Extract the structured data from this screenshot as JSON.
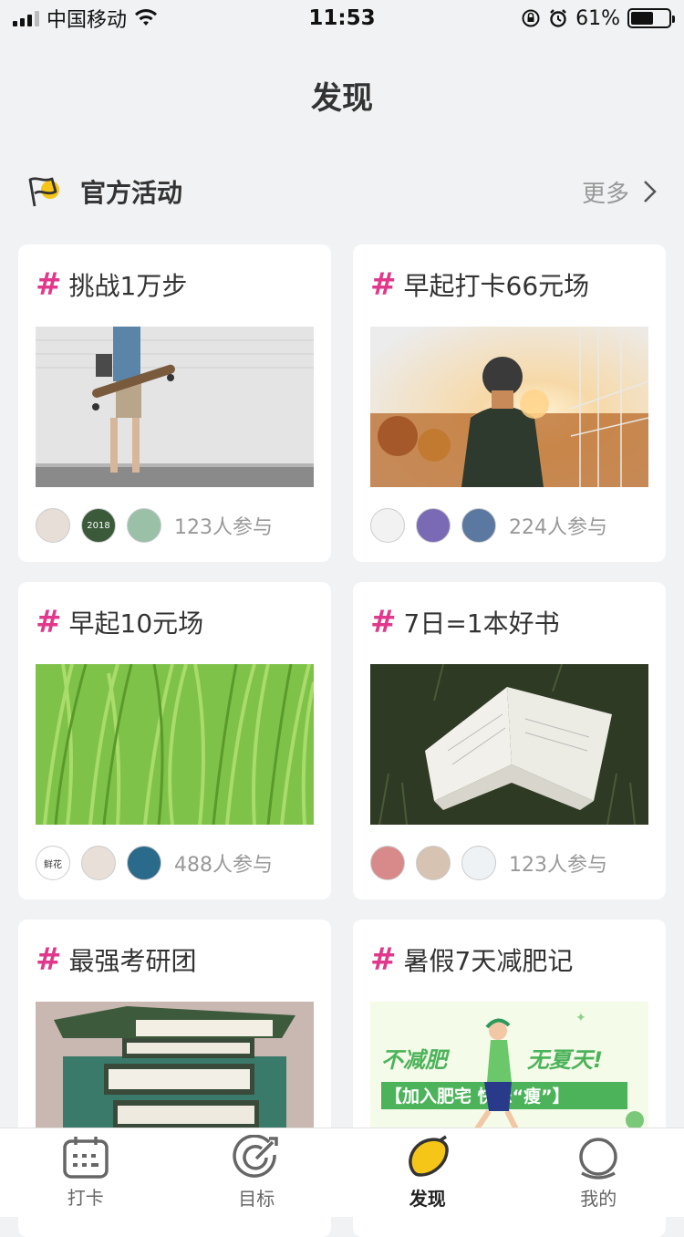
{
  "status_bar": {
    "carrier": "中国移动",
    "time": "11:53",
    "battery_pct": "61%",
    "battery_level": 0.61
  },
  "page": {
    "title": "发现"
  },
  "section": {
    "title": "官方活动",
    "more_label": "更多",
    "flag_color": "#f5c518"
  },
  "activities": [
    {
      "title": "挑战1万步",
      "joined": "123人参与",
      "image": "skateboard-walker-photo",
      "avatar_text": [
        "",
        "2018",
        ""
      ]
    },
    {
      "title": "早起打卡66元场",
      "joined": "224人参与",
      "image": "sunrise-man-photo",
      "avatar_text": [
        "",
        "",
        ""
      ]
    },
    {
      "title": "早起10元场",
      "joined": "488人参与",
      "image": "green-grass-photo",
      "avatar_text": [
        "鲜花",
        "",
        ""
      ]
    },
    {
      "title": "7日=1本好书",
      "joined": "123人参与",
      "image": "open-book-on-grass-photo",
      "avatar_text": [
        "",
        "",
        ""
      ]
    },
    {
      "title": "最强考研团",
      "joined": "",
      "image": "book-stack-photo",
      "avatar_text": []
    },
    {
      "title": "暑假7天减肥记",
      "joined": "",
      "image": "runner-illustration",
      "banner_line1": "不减肥",
      "banner_line1b": "无夏天!",
      "banner_line2": "【加入肥宅 快乐“瘦”】",
      "avatar_text": []
    }
  ],
  "tabbar": {
    "items": [
      {
        "label": "打卡",
        "icon": "calendar-icon"
      },
      {
        "label": "目标",
        "icon": "target-icon"
      },
      {
        "label": "发现",
        "icon": "lemon-icon",
        "active": true
      },
      {
        "label": "我的",
        "icon": "profile-icon"
      }
    ]
  },
  "colors": {
    "accent_hash": "#e0398c",
    "background": "#f0f2f3"
  }
}
